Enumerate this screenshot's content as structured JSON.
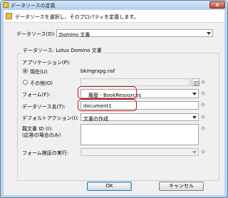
{
  "window": {
    "title": "データソースの定義",
    "close_label": "x"
  },
  "header": {
    "description": "データソースを選択し、そのプロパティを定義します。"
  },
  "datasource": {
    "label": "データソース(D):",
    "value": "Domino 文書"
  },
  "group": {
    "title": "データソース: Lotus Domino 文書",
    "application_label": "アプリケーション(P):",
    "radio_current_label": "現在(U)",
    "radio_current_value": "bkmgrxpg.nsf",
    "radio_other_label": "その他(O)",
    "form_label": "フォーム(F):",
    "form_value": "履歴  -  BookResources",
    "ds_name_label": "データソース名(T):",
    "ds_name_value": "document1",
    "default_action_label": "デフォルトアクション(I):",
    "default_action_value": "文書の作成",
    "parent_id_label_line1": "親文書 ID (I):",
    "parent_id_label_line2": "(応答の場合のみ)",
    "form_validation_label": "フォーム検証の実行:"
  },
  "buttons": {
    "ok": "OK",
    "cancel": "キャンセル"
  }
}
